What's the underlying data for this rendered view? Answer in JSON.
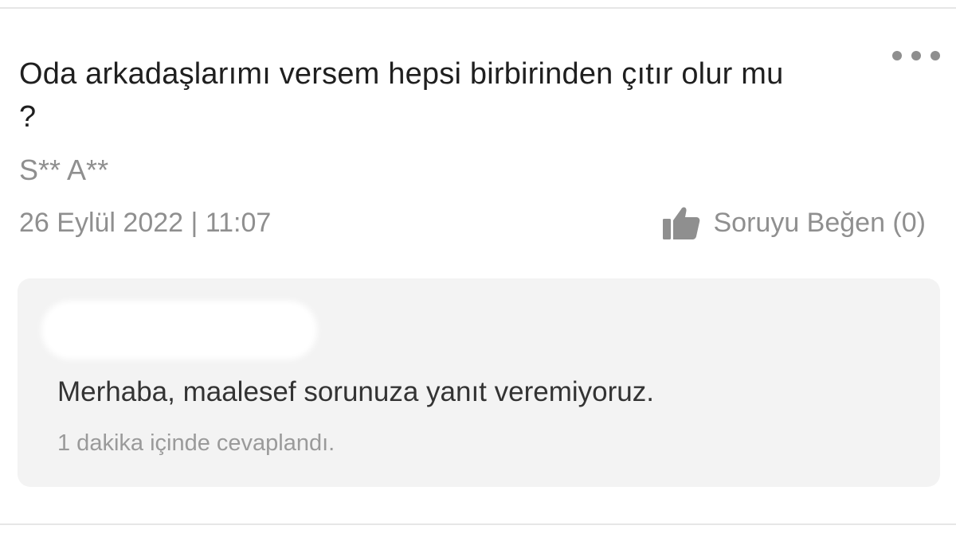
{
  "question": {
    "title": "Oda arkadaşlarımı versem hepsi birbirinden çıtır olur mu ?",
    "author": "S** A**",
    "datetime": "26 Eylül 2022 | 11:07",
    "like_label": "Soruyu Beğen (0)",
    "like_count": 0,
    "menu_icon": "more-dots-icon",
    "like_icon": "thumbs-up-icon"
  },
  "answer": {
    "text": "Merhaba, maalesef sorunuza yanıt veremiyoruz.",
    "meta": "1 dakika içinde cevaplandı."
  },
  "colors": {
    "title": "#1f1f1f",
    "muted": "#8f8f8f",
    "card_bg": "#f3f3f3",
    "divider": "#e6e6e6"
  }
}
